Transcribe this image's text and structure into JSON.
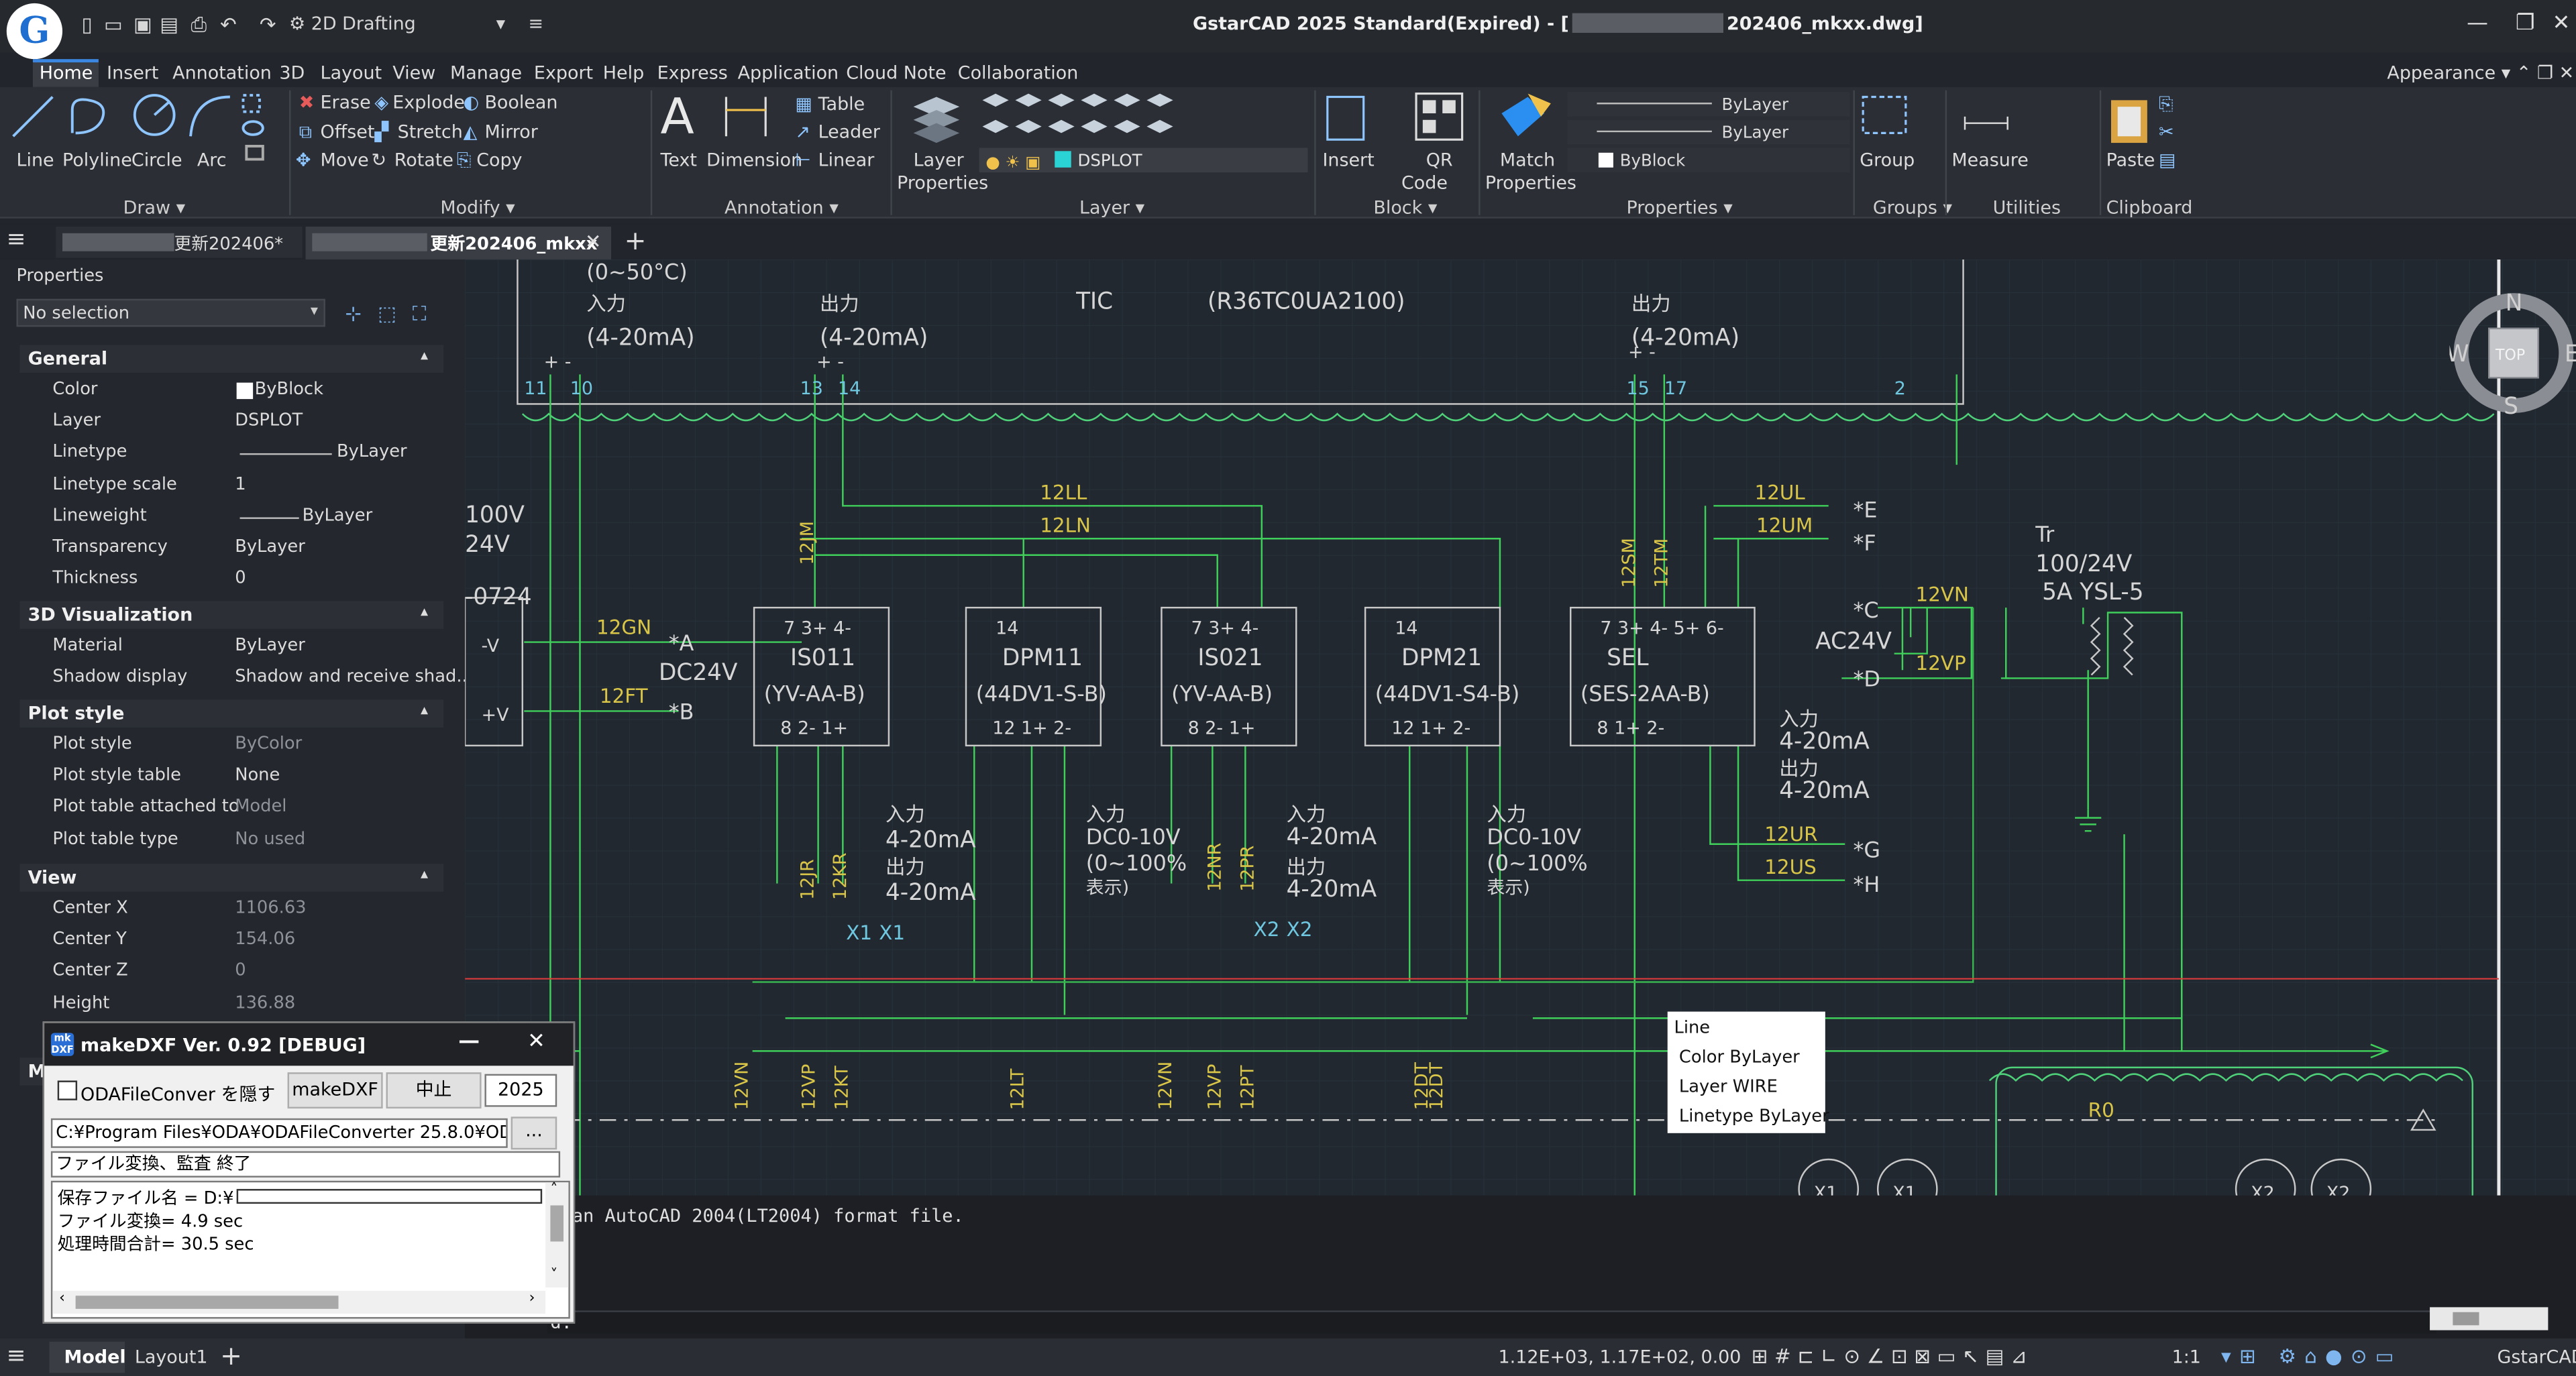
{
  "app": {
    "workspace": "2D Drafting",
    "title_prefix": "GstarCAD 2025 Standard(Expired) - [",
    "title_suffix": "202406_mkxx.dwg]",
    "appearance": "Appearance"
  },
  "menu": [
    "Home",
    "Insert",
    "Annotation",
    "3D",
    "Layout",
    "View",
    "Manage",
    "Export",
    "Help",
    "Express",
    "Application",
    "Cloud Note",
    "Collaboration"
  ],
  "ribbon": {
    "draw": {
      "line": "Line",
      "polyline": "Polyline",
      "circle": "Circle",
      "arc": "Arc",
      "panel": "Draw"
    },
    "modify": {
      "erase": "Erase",
      "explode": "Explode",
      "boolean": "Boolean",
      "offset": "Offset",
      "stretch": "Stretch",
      "mirror": "Mirror",
      "move": "Move",
      "rotate": "Rotate",
      "copy": "Copy",
      "panel": "Modify"
    },
    "annotation": {
      "text": "Text",
      "dimension": "Dimension",
      "table": "Table",
      "leader": "Leader",
      "linear": "Linear",
      "panel": "Annotation"
    },
    "layer": {
      "props1": "Layer",
      "props2": "Properties",
      "current": "DSPLOT",
      "panel": "Layer"
    },
    "block": {
      "insert": "Insert",
      "qr1": "QR",
      "qr2": "Code",
      "panel": "Block"
    },
    "properties": {
      "match1": "Match",
      "match2": "Properties",
      "linetype": "ByLayer",
      "lineweight": "ByLayer",
      "color": "ByBlock",
      "panel": "Properties"
    },
    "groups": {
      "group": "Group",
      "panel": "Groups"
    },
    "utilities": {
      "measure": "Measure",
      "panel": "Utilities"
    },
    "clipboard": {
      "paste": "Paste",
      "panel": "Clipboard"
    }
  },
  "tabs": {
    "tab1": "更新202406*",
    "tab2": "更新202406_mkxx"
  },
  "properties": {
    "header": "Properties",
    "selection": "No selection",
    "general": {
      "title": "General",
      "rows": [
        [
          "Color",
          "ByBlock"
        ],
        [
          "Layer",
          "DSPLOT"
        ],
        [
          "Linetype",
          "ByLayer"
        ],
        [
          "Linetype scale",
          "1"
        ],
        [
          "Lineweight",
          "ByLayer"
        ],
        [
          "Transparency",
          "ByLayer"
        ],
        [
          "Thickness",
          "0"
        ]
      ]
    },
    "viz": {
      "title": "3D Visualization",
      "rows": [
        [
          "Material",
          "ByLayer"
        ],
        [
          "Shadow display",
          "Shadow and receive shad..."
        ]
      ]
    },
    "plot": {
      "title": "Plot style",
      "rows": [
        [
          "Plot style",
          "ByColor"
        ],
        [
          "Plot style table",
          "None"
        ],
        [
          "Plot table attached to",
          "Model"
        ],
        [
          "Plot table type",
          "No used"
        ]
      ]
    },
    "view": {
      "title": "View",
      "rows": [
        [
          "Center X",
          "1106.63"
        ],
        [
          "Center Y",
          "154.06"
        ],
        [
          "Center Z",
          "0"
        ],
        [
          "Height",
          "136.88"
        ]
      ]
    },
    "misc_title": "Mi"
  },
  "makedxf": {
    "title": "makeDXF Ver. 0.92 [DEBUG]",
    "checkbox": "ODAFileConver を隠す",
    "btn_make": "makeDXF",
    "btn_stop": "中止",
    "year": "2025",
    "path": "C:¥Program Files¥ODA¥ODAFileConverter 25.8.0¥OD",
    "browse": "...",
    "status": "ファイル変換、監査 終了",
    "log1": "保存ファイル名 = D:¥",
    "log2": "ファイル変換= 4.9 sec",
    "log3": "処理時間合計= 30.5 sec"
  },
  "tooltip": {
    "title": "Line",
    "color": "Color  ByLayer",
    "layer": "Layer  WIRE",
    "linetype": "Linetype  ByLayer"
  },
  "command": {
    "line1": "g an AutoCAD 2004(LT2004) format file.",
    "line2": "d:",
    "line3": "d:",
    "prompt": "d:"
  },
  "status": {
    "model": "Model",
    "layout": "Layout1",
    "coords": "1.12E+03, 1.17E+02, 0.00",
    "scale": "1:1",
    "brand": "GstarCAD"
  },
  "viewcube": {
    "n": "N",
    "w": "W",
    "e": "E",
    "s": "S",
    "top": "TOP"
  },
  "drawing": {
    "header": {
      "range": "(0~50°C)",
      "in1": "入力",
      "in1v": "(4-20mA)",
      "out1": "出力",
      "out1v": "(4-20mA)",
      "tic": "TIC",
      "tag": "(R36TC0UA2100)",
      "out2": "出力",
      "out2v": "(4-20mA)",
      "n11": "11",
      "n10": "10",
      "n13": "13",
      "n14": "14",
      "n15": "15",
      "n17": "17",
      "n2": "2",
      "pm": "+ -"
    },
    "left": {
      "v100": "100V",
      "v24": "24V",
      "code": "-0724",
      "mv": "-V",
      "pv": "+V",
      "dc": "DC24V",
      "gn": "12GN",
      "ft": "12FT",
      "a": "*A",
      "b": "*B"
    },
    "wires": {
      "ll": "12LL",
      "ln": "12LN",
      "jm": "12JM",
      "sm": "12SM",
      "tm": "12TM",
      "ul": "12UL",
      "um": "12UM",
      "vn": "12VN",
      "vp": "12VP",
      "ur": "12UR",
      "us": "12US",
      "jr": "12JR",
      "kr": "12KR",
      "nr": "12NR",
      "pr": "12PR"
    },
    "boxes": [
      {
        "top": "7  3+  4-",
        "name": "IS011",
        "model": "(YV-AA-B)",
        "bot": "8  2-  1+"
      },
      {
        "top": "14",
        "name": "DPM11",
        "model": "(44DV1-S-B)",
        "bot": "12  1+  2-"
      },
      {
        "top": "7  3+  4-",
        "name": "IS021",
        "model": "(YV-AA-B)",
        "bot": "8  2-  1+"
      },
      {
        "top": "14",
        "name": "DPM21",
        "model": "(44DV1-S4-B)",
        "bot": "12  1+  2-"
      },
      {
        "top": "7  3+  4-  5+  6-",
        "name": "SEL",
        "model": "(SES-2AA-B)",
        "bot": "8            1+  2-"
      }
    ],
    "notes": {
      "in": "入力",
      "out": "出力",
      "v420": "4-20mA",
      "dc010": "DC0-10V",
      "pct": "(0~100%",
      "disp": "表示)"
    },
    "right": {
      "e": "*E",
      "f": "*F",
      "c": "*C",
      "d": "*D",
      "g": "*G",
      "h": "*H",
      "ac": "AC24V",
      "tr": "Tr",
      "trv": "100/24V",
      "try": "5A YSL-5"
    },
    "relays": {
      "x1": "X1",
      "x2": "X2",
      "r0": "R0"
    },
    "bottom": [
      "12VN",
      "12VP",
      "12KT",
      "12LT",
      "12VN",
      "12VP",
      "12PT",
      "12DT",
      "12DT"
    ]
  }
}
